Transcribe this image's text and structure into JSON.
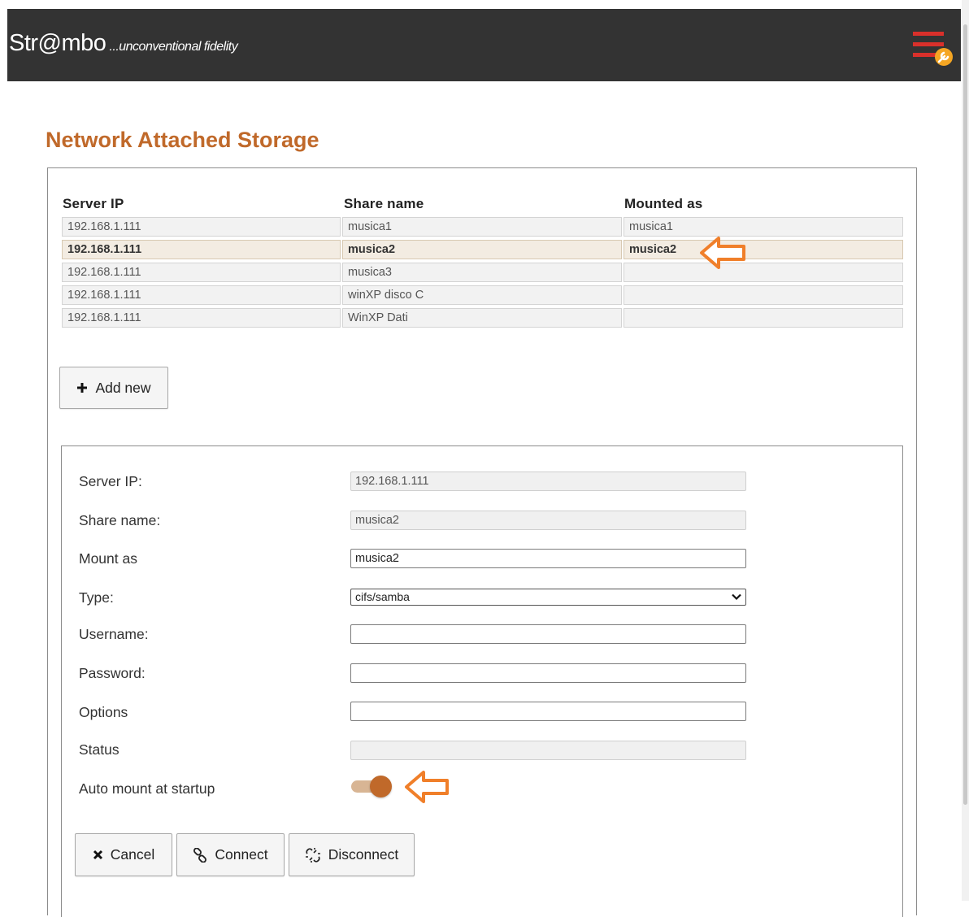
{
  "header": {
    "brand_name": "Str@mbo",
    "brand_tagline": "...unconventional fidelity",
    "menu_icon": "hamburger-wrench-icon"
  },
  "page": {
    "title": "Network Attached Storage"
  },
  "table": {
    "columns": [
      "Server IP",
      "Share name",
      "Mounted as"
    ],
    "rows": [
      {
        "server_ip": "192.168.1.111",
        "share": "musica1",
        "mounted": "musica1"
      },
      {
        "server_ip": "192.168.1.111",
        "share": "musica2",
        "mounted": "musica2",
        "selected": true
      },
      {
        "server_ip": "192.168.1.111",
        "share": "musica3",
        "mounted": ""
      },
      {
        "server_ip": "192.168.1.111",
        "share": "winXP disco C",
        "mounted": ""
      },
      {
        "server_ip": "192.168.1.111",
        "share": "WinXP Dati",
        "mounted": ""
      }
    ]
  },
  "add_new": {
    "label": "Add new",
    "icon": "plus-icon"
  },
  "form": {
    "server_ip_label": "Server IP:",
    "server_ip_value": "192.168.1.111",
    "share_name_label": "Share name:",
    "share_name_value": "musica2",
    "mount_as_label": "Mount as",
    "mount_as_value": "musica2",
    "type_label": "Type:",
    "type_value": "cifs/samba",
    "username_label": "Username:",
    "username_value": "",
    "password_label": "Password:",
    "password_value": "",
    "options_label": "Options",
    "options_value": "",
    "status_label": "Status",
    "status_value": "",
    "automount_label": "Auto mount at startup",
    "automount_on": true
  },
  "actions": {
    "cancel_label": "Cancel",
    "connect_label": "Connect",
    "disconnect_label": "Disconnect"
  },
  "colors": {
    "accent": "#c0692a",
    "header_bg": "#333333",
    "annotation_arrow": "#f07f2a",
    "menu_red": "#d9302b"
  }
}
